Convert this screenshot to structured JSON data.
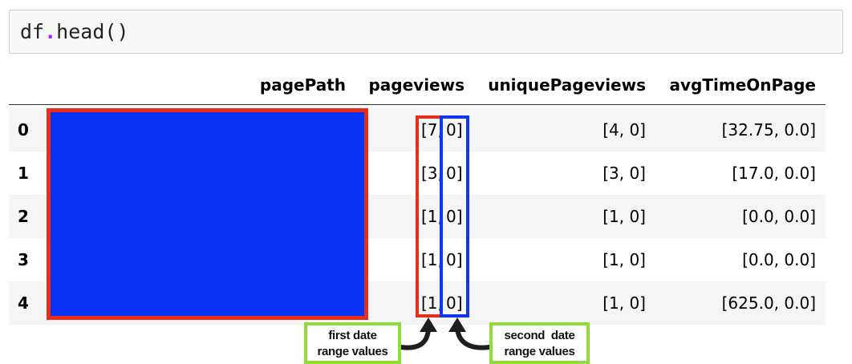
{
  "code_cell": {
    "name": "df",
    "dot": ".",
    "method": "head",
    "parens": "()"
  },
  "table": {
    "columns": [
      "pagePath",
      "pageviews",
      "uniquePageviews",
      "avgTimeOnPage"
    ],
    "rows": [
      {
        "index": "0",
        "pageviews_first": "[7,",
        "pageviews_second": "0]",
        "uniquePageviews": "[4, 0]",
        "avgTimeOnPage": "[32.75, 0.0]"
      },
      {
        "index": "1",
        "pageviews_first": "[3,",
        "pageviews_second": "0]",
        "uniquePageviews": "[3, 0]",
        "avgTimeOnPage": "[17.0, 0.0]"
      },
      {
        "index": "2",
        "pageviews_first": "[1,",
        "pageviews_second": "0]",
        "uniquePageviews": "[1, 0]",
        "avgTimeOnPage": "[0.0, 0.0]"
      },
      {
        "index": "3",
        "pageviews_first": "[1,",
        "pageviews_second": "0]",
        "uniquePageviews": "[1, 0]",
        "avgTimeOnPage": "[0.0, 0.0]"
      },
      {
        "index": "4",
        "pageviews_first": "[1,",
        "pageviews_second": "0]",
        "uniquePageviews": "[1, 0]",
        "avgTimeOnPage": "[625.0, 0.0]"
      }
    ]
  },
  "annotations": {
    "first": {
      "line1": "first date",
      "line2": "range values"
    },
    "second": {
      "line1": "second  date",
      "line2": "range values"
    }
  },
  "colors": {
    "redaction_fill": "#0a32f7",
    "red_highlight": "#e62e1a",
    "blue_highlight": "#1036ee",
    "callout_border": "#8fdc3a",
    "code_keyword_purple": "#aa22ff"
  }
}
